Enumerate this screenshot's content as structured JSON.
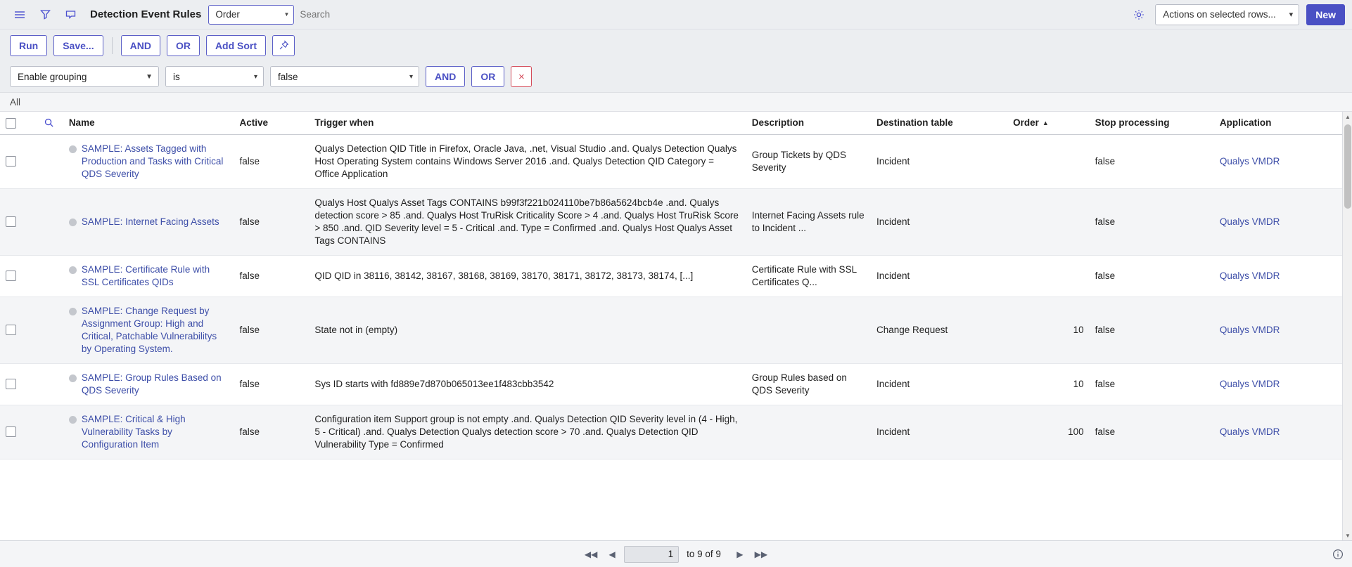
{
  "header": {
    "menu_icon": "hamburger-icon",
    "filter_icon": "funnel-icon",
    "comment_icon": "speech-bubble-icon",
    "title": "Detection Event Rules",
    "order_select_value": "Order",
    "search_placeholder": "Search",
    "gear_icon": "gear-icon",
    "actions_select_value": "Actions on selected rows...",
    "new_label": "New"
  },
  "toolbar": {
    "run_label": "Run",
    "save_label": "Save...",
    "and_label": "AND",
    "or_label": "OR",
    "add_sort_label": "Add Sort",
    "pin_icon": "pin-icon"
  },
  "filter": {
    "field_value": "Enable grouping",
    "operator_value": "is",
    "value_value": "false",
    "and_label": "AND",
    "or_label": "OR",
    "remove_label": "×"
  },
  "breadcrumb": {
    "label": "All"
  },
  "table": {
    "search_icon": "magnifier-icon",
    "sort_indicator": "▲",
    "columns": [
      {
        "key": "name",
        "label": "Name"
      },
      {
        "key": "active",
        "label": "Active"
      },
      {
        "key": "trigger",
        "label": "Trigger when"
      },
      {
        "key": "description",
        "label": "Description"
      },
      {
        "key": "destination",
        "label": "Destination table"
      },
      {
        "key": "order",
        "label": "Order"
      },
      {
        "key": "stop",
        "label": "Stop processing"
      },
      {
        "key": "application",
        "label": "Application"
      }
    ],
    "rows": [
      {
        "name": "SAMPLE: Assets Tagged with Production and Tasks with Critical QDS Severity",
        "active": "false",
        "trigger": "Qualys Detection QID Title in Firefox, Oracle Java, .net, Visual Studio .and. Qualys Detection Qualys Host Operating System contains Windows Server 2016 .and. Qualys Detection QID Category = Office Application",
        "description": "Group Tickets by QDS Severity",
        "destination": "Incident",
        "order": "",
        "stop": "false",
        "application": "Qualys VMDR"
      },
      {
        "name": "SAMPLE: Internet Facing Assets",
        "active": "false",
        "trigger": "Qualys Host Qualys Asset Tags CONTAINS b99f3f221b024110be7b86a5624bcb4e .and. Qualys detection score > 85 .and. Qualys Host TruRisk Criticality Score > 4 .and. Qualys Host TruRisk Score > 850 .and. QID Severity level = 5 - Critical .and. Type = Confirmed .and. Qualys Host Qualys Asset Tags CONTAINS",
        "description": "Internet Facing Assets rule to Incident ...",
        "destination": "Incident",
        "order": "",
        "stop": "false",
        "application": "Qualys VMDR"
      },
      {
        "name": "SAMPLE: Certificate Rule with SSL Certificates QIDs",
        "active": "false",
        "trigger": "QID QID in 38116, 38142, 38167, 38168, 38169, 38170, 38171, 38172, 38173, 38174, [...]",
        "description": "Certificate Rule with SSL Certificates Q...",
        "destination": "Incident",
        "order": "",
        "stop": "false",
        "application": "Qualys VMDR"
      },
      {
        "name": "SAMPLE: Change Request by Assignment Group: High and Critical, Patchable Vulnerabilitys by Operating System.",
        "active": "false",
        "trigger": "State not in (empty)",
        "description": "",
        "destination": "Change Request",
        "order": "10",
        "stop": "false",
        "application": "Qualys VMDR"
      },
      {
        "name": "SAMPLE: Group Rules Based on QDS Severity",
        "active": "false",
        "trigger": "Sys ID starts with fd889e7d870b065013ee1f483cbb3542",
        "description": "Group Rules based on QDS Severity",
        "destination": "Incident",
        "order": "10",
        "stop": "false",
        "application": "Qualys VMDR"
      },
      {
        "name": "SAMPLE: Critical & High Vulnerability Tasks by Configuration Item",
        "active": "false",
        "trigger": "Configuration item Support group is not empty .and. Qualys Detection QID Severity level in (4 - High, 5 - Critical) .and. Qualys Detection Qualys detection score > 70 .and. Qualys Detection QID Vulnerability Type = Confirmed",
        "description": "",
        "destination": "Incident",
        "order": "100",
        "stop": "false",
        "application": "Qualys VMDR"
      }
    ]
  },
  "pagination": {
    "first_icon": "◀◀",
    "prev_icon": "◀",
    "page_value": "1",
    "range_label": "to 9 of 9",
    "next_icon": "▶",
    "last_icon": "▶▶",
    "info_icon": "info-icon"
  },
  "colors": {
    "accent": "#4a50c4",
    "link": "#3d4ea8",
    "toolbar_bg": "#eceef1",
    "danger": "#d44b5a"
  }
}
